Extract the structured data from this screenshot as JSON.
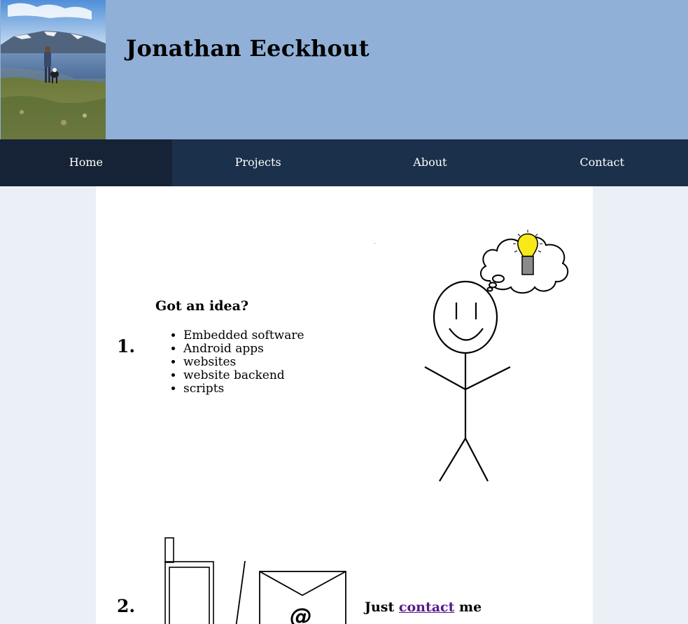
{
  "header": {
    "title": "Jonathan Eeckhout",
    "background_color": "#91b0d7",
    "photo_icon": "profile-photo"
  },
  "nav": {
    "background_color": "#1b304a",
    "active_color": "#162236",
    "items": [
      {
        "label": "Home",
        "active": true
      },
      {
        "label": "Projects",
        "active": false
      },
      {
        "label": "About",
        "active": false
      },
      {
        "label": "Contact",
        "active": false
      }
    ]
  },
  "main": {
    "steps": [
      {
        "number": "1.",
        "heading": "Got an idea?",
        "items": [
          "Embedded software",
          "Android apps",
          "websites",
          "website backend",
          "scripts"
        ],
        "illustration": "stickman-lightbulb-icon"
      },
      {
        "number": "2.",
        "text_before": "Just",
        "link_label": "contact",
        "text_after": "me",
        "link_color": "#551a8b",
        "illustration": "phone-and-envelope-icon",
        "envelope_symbol": "@"
      }
    ]
  }
}
